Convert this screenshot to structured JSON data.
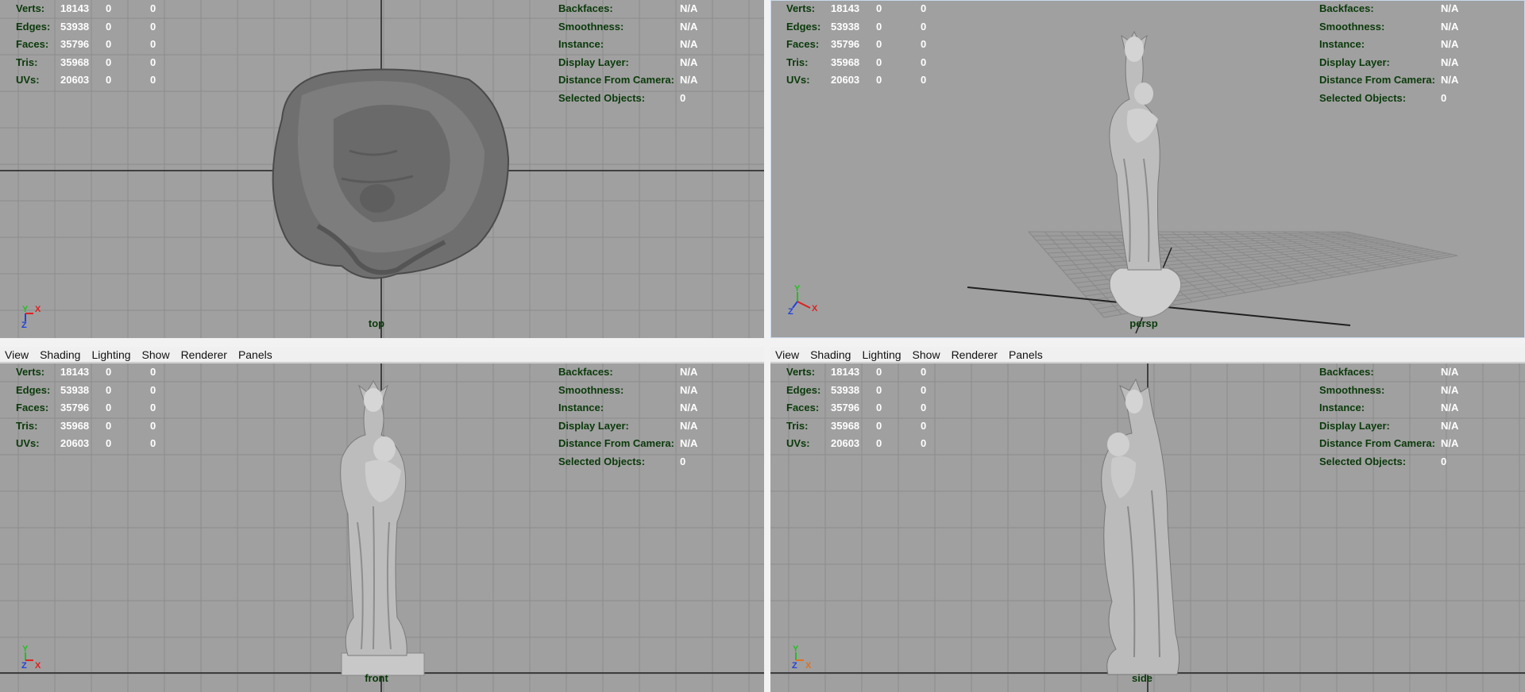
{
  "menu": {
    "view": "View",
    "shading": "Shading",
    "lighting": "Lighting",
    "show": "Show",
    "renderer": "Renderer",
    "panels": "Panels"
  },
  "hud": {
    "verts_label": "Verts:",
    "verts": [
      "18143",
      "0",
      "0"
    ],
    "edges_label": "Edges:",
    "edges": [
      "53938",
      "0",
      "0"
    ],
    "faces_label": "Faces:",
    "faces": [
      "35796",
      "0",
      "0"
    ],
    "tris_label": "Tris:",
    "tris": [
      "35968",
      "0",
      "0"
    ],
    "uvs_label": "UVs:",
    "uvs": [
      "20603",
      "0",
      "0"
    ],
    "backfaces_label": "Backfaces:",
    "backfaces": "N/A",
    "smoothness_label": "Smoothness:",
    "smoothness": "N/A",
    "instance_label": "Instance:",
    "instance": "N/A",
    "display_layer_label": "Display Layer:",
    "display_layer": "N/A",
    "distance_label": "Distance From Camera:",
    "distance": "N/A",
    "selected_label": "Selected Objects:",
    "selected": "0"
  },
  "viewports": {
    "top": "top",
    "persp": "persp",
    "front": "front",
    "side": "side"
  },
  "axes": {
    "x": "X",
    "y": "Y",
    "z": "Z"
  },
  "colors": {
    "viewport_bg": "#a0a0a0",
    "grid": "#8c8c8c",
    "axis_line": "#202020",
    "hud_label": "#0a3a0a",
    "hud_value": "#ffffff",
    "axis_x": "#e02020",
    "axis_y": "#20c020",
    "axis_z": "#2040e0",
    "axis_x_side": "#e07020"
  }
}
